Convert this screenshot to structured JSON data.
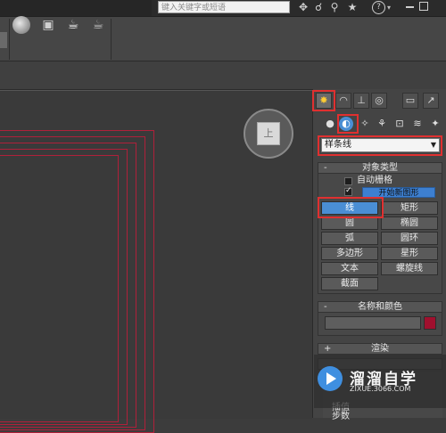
{
  "topbar": {
    "search_placeholder": "键入关键字或短语",
    "help_glyph": "?"
  },
  "command_panel": {
    "object_category": "样条线",
    "object_type": {
      "header_sign": "-",
      "title": "对象类型",
      "autogrid_label": "自动栅格",
      "start_new_shape_label": "开始新图形",
      "buttons": [
        "线",
        "矩形",
        "圆",
        "椭圆",
        "弧",
        "圆环",
        "多边形",
        "星形",
        "文本",
        "螺旋线",
        "截面"
      ],
      "active_button": "线"
    },
    "name_color": {
      "header_sign": "-",
      "title": "名称和颜色",
      "object_color": "#a0102e"
    },
    "rendering": {
      "header_sign": "+",
      "title": "渲染"
    },
    "interpolation_partial": [
      "插值",
      "步数"
    ]
  },
  "watermark": {
    "title": "溜溜自学",
    "url": "ZIXUE.3066.COM"
  },
  "colors": {
    "highlight": "#e03030",
    "active_button": "#4a8ed4",
    "spline_lines": "#b0203a"
  }
}
